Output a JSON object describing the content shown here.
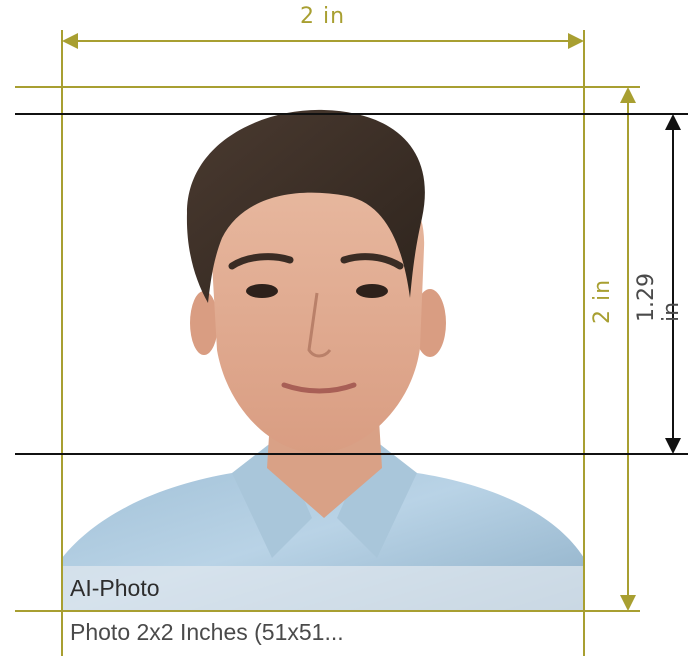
{
  "dimensions": {
    "width_label": "2 in",
    "height_label": "2 in",
    "head_label": "1.29 in"
  },
  "photo": {
    "caption": "AI-Photo"
  },
  "footer": {
    "title": "Photo 2x2 Inches (51x51..."
  },
  "colors": {
    "accent": "#a89f31",
    "guide": "#111111"
  }
}
